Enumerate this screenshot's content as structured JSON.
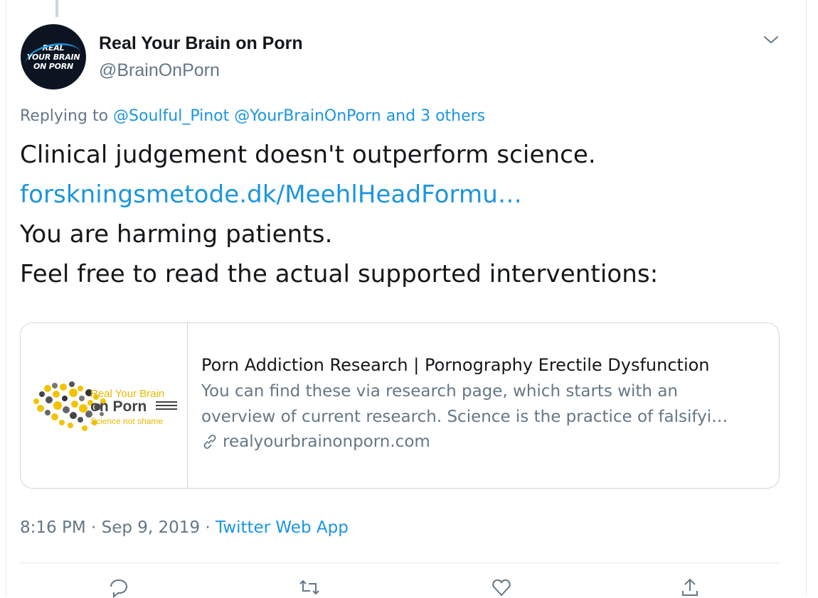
{
  "author": {
    "display_name": "Real Your Brain on Porn",
    "handle": "@BrainOnPorn",
    "avatar_text": "REAL\nYOUR BRAIN\nON PORN"
  },
  "reply": {
    "prefix": "Replying to",
    "mentions": [
      "@Soulful_Pinot",
      "@YourBrainOnPorn"
    ],
    "others": "and 3 others"
  },
  "tweet": {
    "line1": "Clinical judgement doesn't outperform science.",
    "url": "forskningsmetode.dk/MeehlHeadFormu…",
    "line3": "You are harming patients.",
    "line4": "Feel free to read the actual supported interventions:"
  },
  "link_card": {
    "logo": {
      "line1": "Real Your Brain",
      "line2": "on Porn",
      "tagline": "Science not shame"
    },
    "title": "Porn Addiction Research | Pornography Erectile Dysfunction",
    "description_line1": "You can find these via research page, which starts with an",
    "description_line2": "overview of current research. Science is the practice of falsifyi…",
    "domain": "realyourbrainonporn.com"
  },
  "meta": {
    "time": "8:16 PM",
    "sep1": "·",
    "date": "Sep 9, 2019",
    "sep2": "·",
    "source": "Twitter Web App"
  },
  "colors": {
    "link": "#1b95e0",
    "secondary_text": "#657786",
    "logo_yellow": "#f2c300",
    "avatar_bg": "#0b1420"
  }
}
